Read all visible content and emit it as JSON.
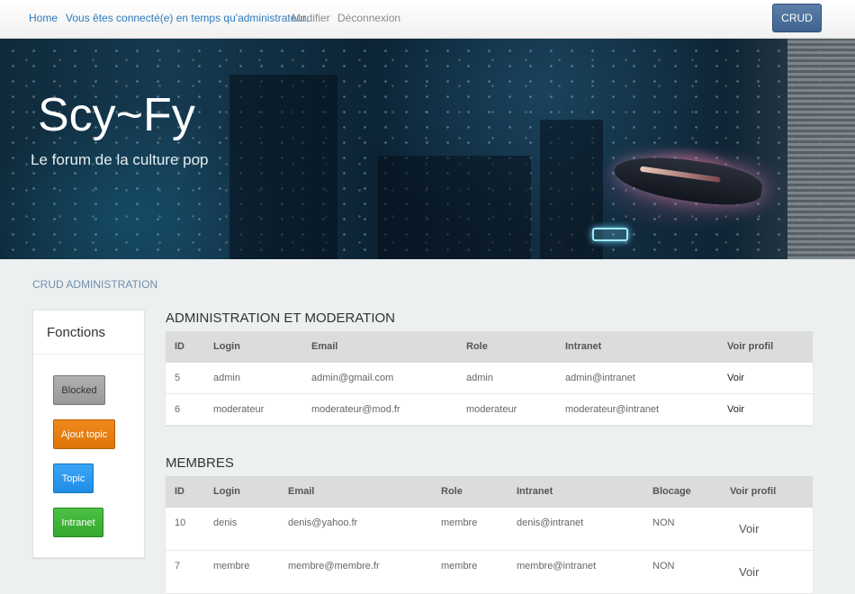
{
  "nav": {
    "home": "Home",
    "connected": "Vous êtes connecté(e) en temps qu'administrateur.",
    "modifier": "Modifier",
    "logout": "Déconnexion",
    "crud_button": "CRUD"
  },
  "hero": {
    "title": "Scy~Fy",
    "subtitle": "Le forum de la culture pop"
  },
  "section_label": "CRUD ADMINISTRATION",
  "sidebar": {
    "title": "Fonctions",
    "buttons": [
      "Blocked",
      "Ajout topic",
      "Topic",
      "Intranet"
    ]
  },
  "admin_table": {
    "title": "ADMINISTRATION ET MODERATION",
    "columns": [
      "ID",
      "Login",
      "Email",
      "Role",
      "Intranet",
      "Voir profil"
    ],
    "rows": [
      {
        "id": "5",
        "login": "admin",
        "email": "admin@gmail.com",
        "role": "admin",
        "intranet": "admin@intranet",
        "voir": "Voir"
      },
      {
        "id": "6",
        "login": "moderateur",
        "email": "moderateur@mod.fr",
        "role": "moderateur",
        "intranet": "moderateur@intranet",
        "voir": "Voir"
      }
    ]
  },
  "members_table": {
    "title": "MEMBRES",
    "columns": [
      "ID",
      "Login",
      "Email",
      "Role",
      "Intranet",
      "Blocage",
      "Voir profil"
    ],
    "rows": [
      {
        "id": "10",
        "login": "denis",
        "email": "denis@yahoo.fr",
        "role": "membre",
        "intranet": "denis@intranet",
        "blocage": "NON",
        "voir": "Voir"
      },
      {
        "id": "7",
        "login": "membre",
        "email": "membre@membre.fr",
        "role": "membre",
        "intranet": "membre@intranet",
        "blocage": "NON",
        "voir": "Voir"
      }
    ]
  }
}
